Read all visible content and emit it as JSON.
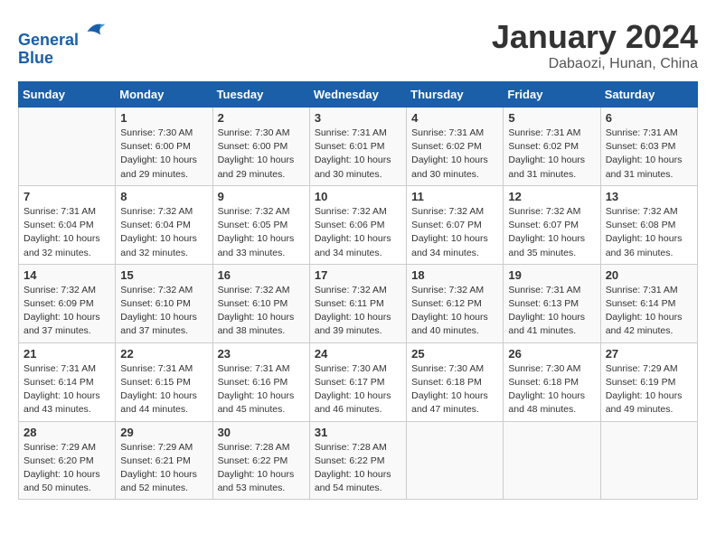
{
  "header": {
    "logo_line1": "General",
    "logo_line2": "Blue",
    "month_year": "January 2024",
    "location": "Dabaozi, Hunan, China"
  },
  "days_of_week": [
    "Sunday",
    "Monday",
    "Tuesday",
    "Wednesday",
    "Thursday",
    "Friday",
    "Saturday"
  ],
  "weeks": [
    [
      {
        "day": "",
        "info": ""
      },
      {
        "day": "1",
        "info": "Sunrise: 7:30 AM\nSunset: 6:00 PM\nDaylight: 10 hours\nand 29 minutes."
      },
      {
        "day": "2",
        "info": "Sunrise: 7:30 AM\nSunset: 6:00 PM\nDaylight: 10 hours\nand 29 minutes."
      },
      {
        "day": "3",
        "info": "Sunrise: 7:31 AM\nSunset: 6:01 PM\nDaylight: 10 hours\nand 30 minutes."
      },
      {
        "day": "4",
        "info": "Sunrise: 7:31 AM\nSunset: 6:02 PM\nDaylight: 10 hours\nand 30 minutes."
      },
      {
        "day": "5",
        "info": "Sunrise: 7:31 AM\nSunset: 6:02 PM\nDaylight: 10 hours\nand 31 minutes."
      },
      {
        "day": "6",
        "info": "Sunrise: 7:31 AM\nSunset: 6:03 PM\nDaylight: 10 hours\nand 31 minutes."
      }
    ],
    [
      {
        "day": "7",
        "info": "Sunrise: 7:31 AM\nSunset: 6:04 PM\nDaylight: 10 hours\nand 32 minutes."
      },
      {
        "day": "8",
        "info": "Sunrise: 7:32 AM\nSunset: 6:04 PM\nDaylight: 10 hours\nand 32 minutes."
      },
      {
        "day": "9",
        "info": "Sunrise: 7:32 AM\nSunset: 6:05 PM\nDaylight: 10 hours\nand 33 minutes."
      },
      {
        "day": "10",
        "info": "Sunrise: 7:32 AM\nSunset: 6:06 PM\nDaylight: 10 hours\nand 34 minutes."
      },
      {
        "day": "11",
        "info": "Sunrise: 7:32 AM\nSunset: 6:07 PM\nDaylight: 10 hours\nand 34 minutes."
      },
      {
        "day": "12",
        "info": "Sunrise: 7:32 AM\nSunset: 6:07 PM\nDaylight: 10 hours\nand 35 minutes."
      },
      {
        "day": "13",
        "info": "Sunrise: 7:32 AM\nSunset: 6:08 PM\nDaylight: 10 hours\nand 36 minutes."
      }
    ],
    [
      {
        "day": "14",
        "info": "Sunrise: 7:32 AM\nSunset: 6:09 PM\nDaylight: 10 hours\nand 37 minutes."
      },
      {
        "day": "15",
        "info": "Sunrise: 7:32 AM\nSunset: 6:10 PM\nDaylight: 10 hours\nand 37 minutes."
      },
      {
        "day": "16",
        "info": "Sunrise: 7:32 AM\nSunset: 6:10 PM\nDaylight: 10 hours\nand 38 minutes."
      },
      {
        "day": "17",
        "info": "Sunrise: 7:32 AM\nSunset: 6:11 PM\nDaylight: 10 hours\nand 39 minutes."
      },
      {
        "day": "18",
        "info": "Sunrise: 7:32 AM\nSunset: 6:12 PM\nDaylight: 10 hours\nand 40 minutes."
      },
      {
        "day": "19",
        "info": "Sunrise: 7:31 AM\nSunset: 6:13 PM\nDaylight: 10 hours\nand 41 minutes."
      },
      {
        "day": "20",
        "info": "Sunrise: 7:31 AM\nSunset: 6:14 PM\nDaylight: 10 hours\nand 42 minutes."
      }
    ],
    [
      {
        "day": "21",
        "info": "Sunrise: 7:31 AM\nSunset: 6:14 PM\nDaylight: 10 hours\nand 43 minutes."
      },
      {
        "day": "22",
        "info": "Sunrise: 7:31 AM\nSunset: 6:15 PM\nDaylight: 10 hours\nand 44 minutes."
      },
      {
        "day": "23",
        "info": "Sunrise: 7:31 AM\nSunset: 6:16 PM\nDaylight: 10 hours\nand 45 minutes."
      },
      {
        "day": "24",
        "info": "Sunrise: 7:30 AM\nSunset: 6:17 PM\nDaylight: 10 hours\nand 46 minutes."
      },
      {
        "day": "25",
        "info": "Sunrise: 7:30 AM\nSunset: 6:18 PM\nDaylight: 10 hours\nand 47 minutes."
      },
      {
        "day": "26",
        "info": "Sunrise: 7:30 AM\nSunset: 6:18 PM\nDaylight: 10 hours\nand 48 minutes."
      },
      {
        "day": "27",
        "info": "Sunrise: 7:29 AM\nSunset: 6:19 PM\nDaylight: 10 hours\nand 49 minutes."
      }
    ],
    [
      {
        "day": "28",
        "info": "Sunrise: 7:29 AM\nSunset: 6:20 PM\nDaylight: 10 hours\nand 50 minutes."
      },
      {
        "day": "29",
        "info": "Sunrise: 7:29 AM\nSunset: 6:21 PM\nDaylight: 10 hours\nand 52 minutes."
      },
      {
        "day": "30",
        "info": "Sunrise: 7:28 AM\nSunset: 6:22 PM\nDaylight: 10 hours\nand 53 minutes."
      },
      {
        "day": "31",
        "info": "Sunrise: 7:28 AM\nSunset: 6:22 PM\nDaylight: 10 hours\nand 54 minutes."
      },
      {
        "day": "",
        "info": ""
      },
      {
        "day": "",
        "info": ""
      },
      {
        "day": "",
        "info": ""
      }
    ]
  ]
}
